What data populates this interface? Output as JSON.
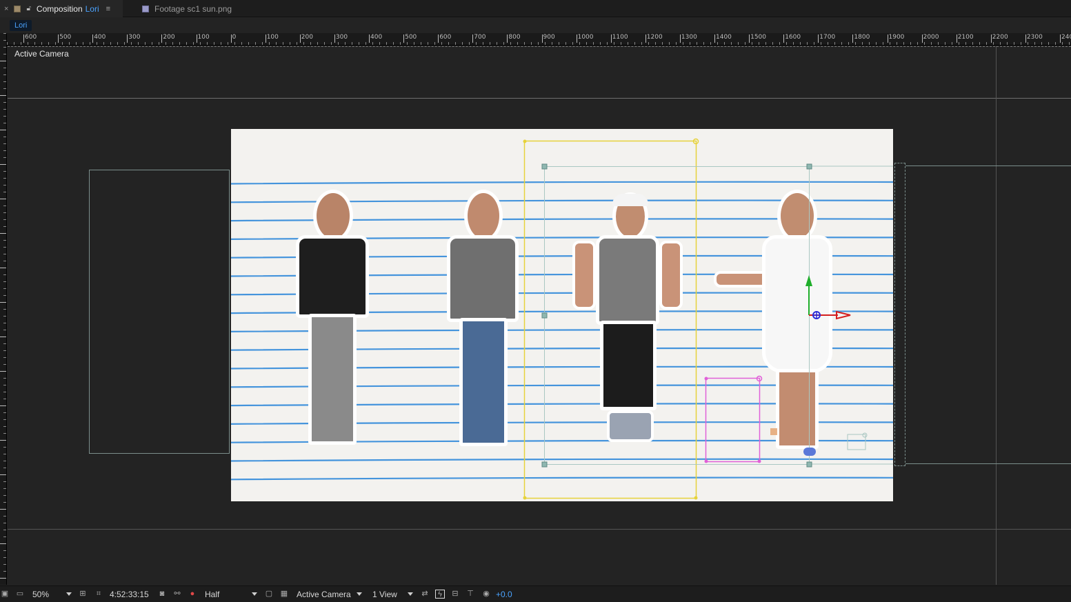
{
  "tabs": [
    {
      "close": "×",
      "prefix": "Composition",
      "name": "Lori",
      "menu": "≡"
    },
    {
      "label": "Footage sc1 sun.png"
    }
  ],
  "breadcrumb": "Lori",
  "ruler_ticks": [
    "600",
    "500",
    "400",
    "300",
    "200",
    "100",
    "0",
    "100",
    "200",
    "300",
    "400",
    "500",
    "600",
    "700",
    "800",
    "900",
    "1000",
    "1100",
    "1200",
    "1300",
    "1400",
    "1500",
    "1600",
    "1700",
    "1800",
    "1900",
    "2000",
    "2100",
    "2200",
    "2300",
    "240"
  ],
  "viewer": {
    "camera_label": "Active Camera"
  },
  "status": {
    "zoom": "50%",
    "timecode": "4:52:33:15",
    "resolution": "Half",
    "camera": "Active Camera",
    "views": "1 View",
    "exposure": "+0.0"
  },
  "colors": {
    "accent": "#4aa3ff",
    "layer_bounds_yellow": "#e6d23a",
    "layer_bounds_pink": "#e060d8",
    "notebook_lines": "#3b8fdc"
  }
}
